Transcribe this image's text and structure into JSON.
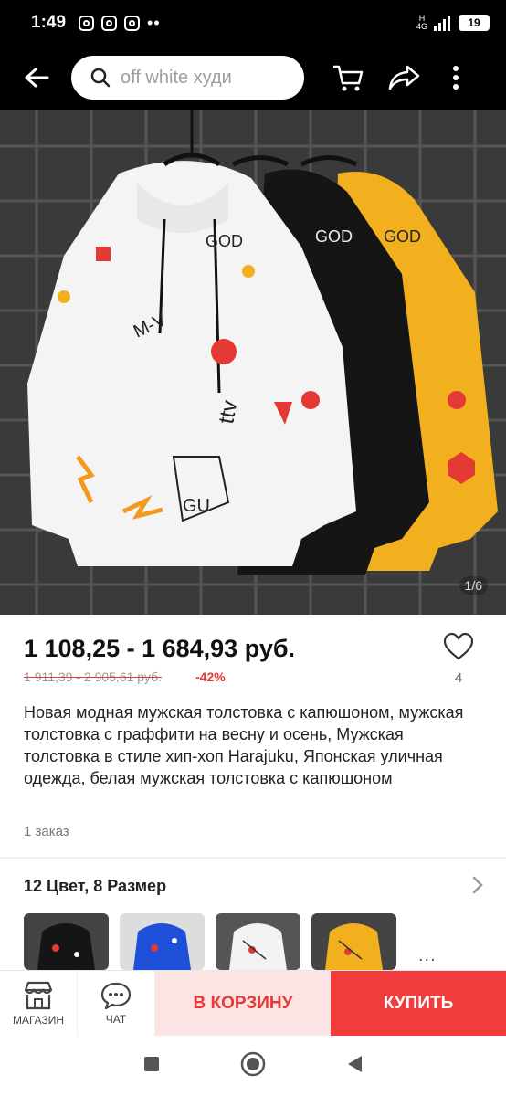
{
  "status": {
    "time": "1:49",
    "network_top": "H",
    "network_bottom": "4G",
    "battery": "19"
  },
  "search": {
    "placeholder": "off white худи"
  },
  "gallery": {
    "counter": "1/6"
  },
  "product": {
    "price": "1 108,25 - 1 684,93 руб.",
    "old_price": "1 911,39 - 2 905,61 руб.",
    "discount": "-42%",
    "favorites": "4",
    "title": "Новая модная мужская толстовка с капюшоном, мужская толстовка с граффити на весну и осень, Мужская толстовка в стиле хип-хоп Harajuku, Японская уличная одежда, белая мужская толстовка с капюшоном",
    "orders": "1 заказ"
  },
  "variants": {
    "heading": "12 Цвет, 8 Размер",
    "more": "..."
  },
  "bottom_bar": {
    "store_label": "МАГАЗИН",
    "chat_label": "ЧАТ",
    "cart_label": "В КОРЗИНУ",
    "buy_label": "КУПИТЬ"
  },
  "colors": {
    "accent": "#f23b3b",
    "cart_bg": "#fde4e4"
  },
  "icons": [
    "back-arrow-icon",
    "search-icon",
    "cart-icon",
    "share-icon",
    "more-vertical-icon",
    "heart-icon",
    "chevron-right-icon",
    "store-icon",
    "chat-icon",
    "nav-square-icon",
    "nav-circle-icon",
    "nav-back-icon"
  ]
}
